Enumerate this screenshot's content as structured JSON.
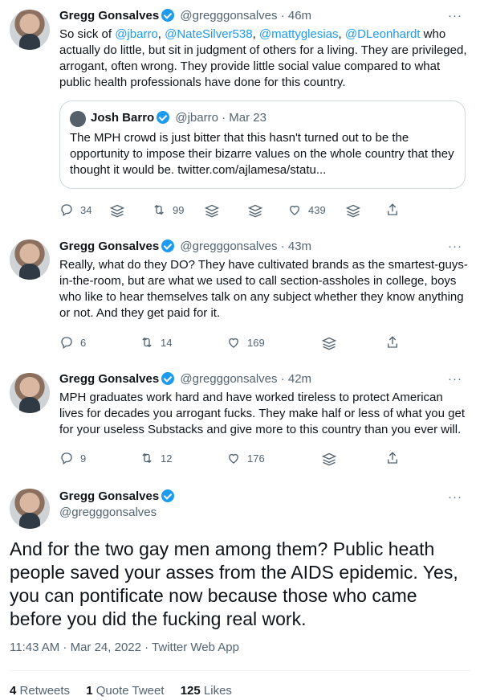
{
  "tweets": [
    {
      "name": "Gregg Gonsalves",
      "handle": "@gregggonsalves",
      "time": "46m",
      "text_parts": [
        "So sick of ",
        "@jbarro",
        ", ",
        "@NateSilver538",
        ", ",
        "@mattyglesias",
        ", ",
        "@DLeonhardt",
        " who actually do little, but sit in judgment of others for a living. They are privileged, arrogant, often wrong. They provide little social value compared to what public health professionals have done for this country."
      ],
      "quote": {
        "name": "Josh Barro",
        "handle": "@jbarro",
        "time": "Mar 23",
        "text": "The MPH crowd is just bitter that this hasn't turned out to be the opportunity to impose their bizarre values on the whole country that they thought it would be. twitter.com/ajlamesa/statu..."
      },
      "replies": "34",
      "retweets": "99",
      "likes": "439"
    },
    {
      "name": "Gregg Gonsalves",
      "handle": "@gregggonsalves",
      "time": "43m",
      "text": "Really, what do they DO? They have cultivated brands as the smartest-guys-in-the-room, but are what we used to call section-assholes in college, boys who like to hear themselves talk on any subject whether they know anything or not. And they get paid for it.",
      "replies": "6",
      "retweets": "14",
      "likes": "169"
    },
    {
      "name": "Gregg Gonsalves",
      "handle": "@gregggonsalves",
      "time": "42m",
      "text": "MPH graduates work hard and have worked tireless to protect American lives for decades you arrogant fucks. They make half or less of what you get for your useless Substacks and give more to this country than you ever will.",
      "replies": "9",
      "retweets": "12",
      "likes": "176"
    }
  ],
  "main_tweet": {
    "name": "Gregg Gonsalves",
    "handle": "@gregggonsalves",
    "text": "And for the two gay men among them? Public heath people saved your asses from the AIDS epidemic. Yes, you can pontificate now because those who came before you did the fucking real work.",
    "timestamp": "11:43 AM · Mar 24, 2022 · Twitter Web App",
    "retweets_count": "4",
    "retweets_label": "Retweets",
    "quotes_count": "1",
    "quotes_label": "Quote Tweet",
    "likes_count": "125",
    "likes_label": "Likes"
  },
  "more_label": "···",
  "separator": "·",
  "colors": {
    "accent": "#1d9bf0",
    "muted": "#536471",
    "text": "#0f1419",
    "border": "#cfd9de"
  },
  "icons": [
    "reply-icon",
    "retweet-icon",
    "like-icon",
    "share-icon",
    "stack-icon",
    "verified-badge-icon",
    "more-icon"
  ]
}
